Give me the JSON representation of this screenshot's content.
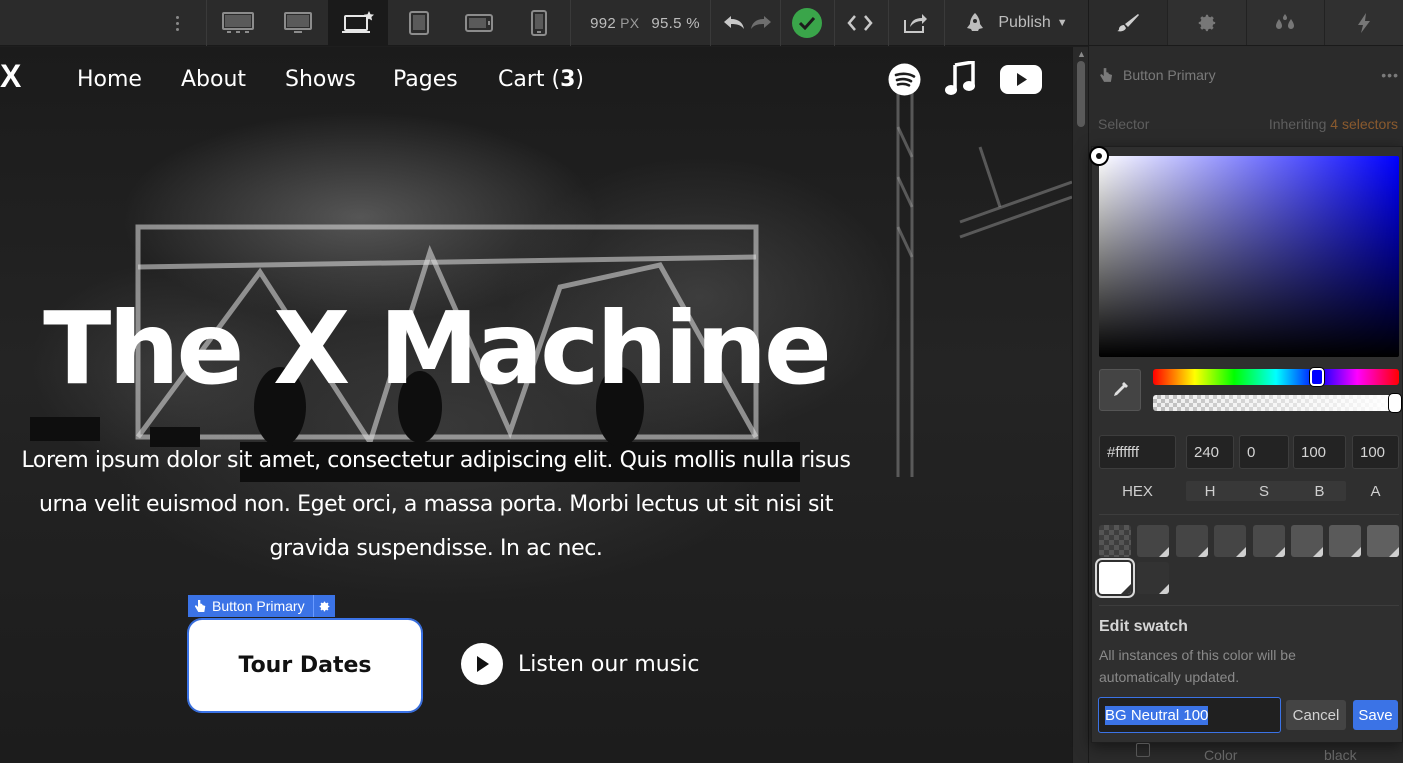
{
  "toolbar": {
    "width_value": "992",
    "width_unit": "PX",
    "zoom": "95.5 %",
    "publish_label": "Publish",
    "colors": {
      "status_ok": "#3aa54a",
      "accent": "#3b73e6"
    }
  },
  "site": {
    "logo": "X",
    "nav": {
      "home": "Home",
      "about": "About",
      "shows": "Shows",
      "pages": "Pages",
      "cart": "Cart",
      "cart_count": "3"
    },
    "social_icons": [
      "spotify-icon",
      "music-note-icon",
      "youtube-icon"
    ],
    "hero": {
      "title": "The X Machine",
      "text": "Lorem ipsum dolor sit amet, consectetur adipiscing elit. Quis mollis nulla risus urna velit euismod non. Eget orci, a massa porta. Morbi lectus ut sit nisi sit gravida suspendisse. In ac nec."
    },
    "selection_tag": "Button Primary",
    "primary_button": "Tour Dates",
    "secondary_button": "Listen our music"
  },
  "panel": {
    "tabs": [
      "brush-icon",
      "gear-icon",
      "drops-icon",
      "lightning-icon"
    ],
    "element_name": "Button Primary",
    "more": "•••",
    "selector_label": "Selector",
    "inheriting_label": "Inheriting",
    "inheriting_count": "4 selectors",
    "bottom_label_color": "Color",
    "bottom_label_value": "black"
  },
  "picker": {
    "hue_value_color": "#0000ff",
    "hex": "#ffffff",
    "h": "240",
    "s": "0",
    "b": "100",
    "a": "100",
    "labels": {
      "hex": "HEX",
      "h": "H",
      "s": "S",
      "b": "B",
      "a": "A"
    },
    "edit_title": "Edit swatch",
    "edit_desc": "All instances of this color will be automatically updated.",
    "swatch_name": "BG Neutral 100",
    "cancel": "Cancel",
    "save": "Save"
  }
}
